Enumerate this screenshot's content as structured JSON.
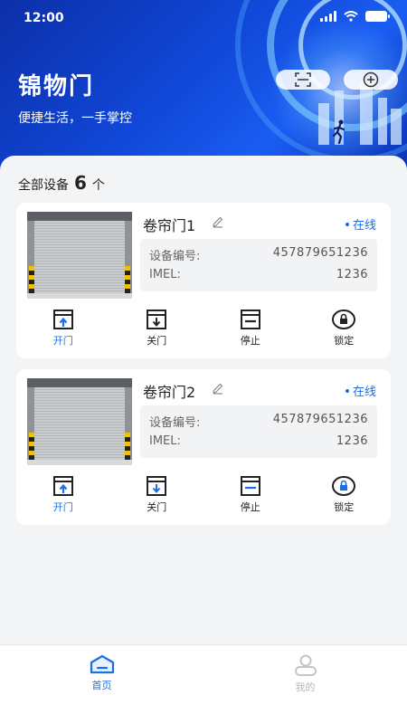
{
  "status_bar": {
    "time": "12:00"
  },
  "header": {
    "title": "锦物门",
    "subtitle": "便捷生活，一手掌控",
    "scan_icon": "scan-icon",
    "add_icon": "add-circle-icon"
  },
  "summary": {
    "label": "全部设备",
    "count": "6",
    "unit": "个"
  },
  "devices": [
    {
      "name": "卷帘门1",
      "status": "在线",
      "serial_label": "设备编号:",
      "serial_value": "457879651236",
      "imel_label": "IMEL:",
      "imel_value": "1236",
      "actions": {
        "open": "开门",
        "close": "关门",
        "stop": "停止",
        "lock": "锁定"
      }
    },
    {
      "name": "卷帘门2",
      "status": "在线",
      "serial_label": "设备编号:",
      "serial_value": "457879651236",
      "imel_label": "IMEL:",
      "imel_value": "1236",
      "actions": {
        "open": "开门",
        "close": "关门",
        "stop": "停止",
        "lock": "锁定"
      }
    }
  ],
  "bottom_nav": [
    {
      "label": "首页",
      "icon": "home-icon",
      "active": true
    },
    {
      "label": "我的",
      "icon": "user-icon",
      "active": false
    }
  ],
  "colors": {
    "accent": "#1a6fe8",
    "header_blue": "#1048d8",
    "text_dark": "#222222"
  }
}
